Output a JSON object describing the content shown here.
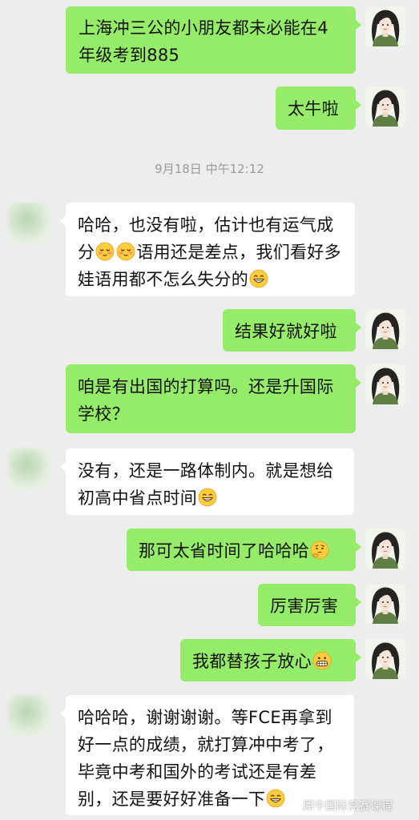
{
  "chat": {
    "timestamp": "9月18日 中午12:12",
    "messages": [
      {
        "side": "right",
        "text": "上海冲三公的小朋友都未必能在4年级考到885"
      },
      {
        "side": "right",
        "text": "太牛啦"
      },
      {
        "side": "left",
        "parts": [
          "哈哈，也没有啦，估计也有运气成分",
          "语用还是差点，我们看好多娃语用都不怎么失分的"
        ]
      },
      {
        "side": "right",
        "text": "结果好就好啦"
      },
      {
        "side": "right",
        "text": "咱是有出国的打算吗。还是升国际学校？"
      },
      {
        "side": "left",
        "text": "没有，还是一路体制内。就是想给初高中省点时间"
      },
      {
        "side": "right",
        "text": "那可太省时间了哈哈哈"
      },
      {
        "side": "right",
        "text": "厉害厉害"
      },
      {
        "side": "right",
        "text": "我都替孩子放心"
      },
      {
        "side": "left",
        "text": "哈哈哈，谢谢谢谢。等FCE再拿到好一点的成绩，就打算冲中考了，毕竟中考和国外的考试还是有差别，还是要好好准备一下"
      }
    ]
  },
  "watermark": {
    "text": "犀牛国际竞赛课程"
  },
  "colors": {
    "background": "#ededed",
    "bubble_self": "#95ec69",
    "bubble_other": "#ffffff"
  }
}
